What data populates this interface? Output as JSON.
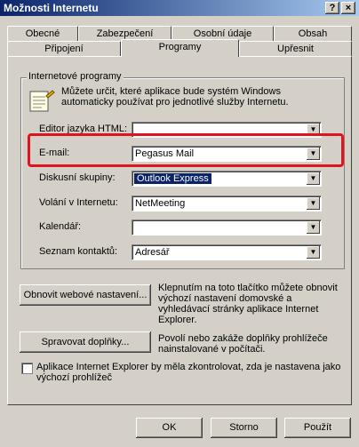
{
  "window": {
    "title": "Možnosti Internetu",
    "help_button": "?",
    "close_button": "×"
  },
  "tabs": {
    "row_back": [
      "Obecné",
      "Zabezpečení",
      "Osobní údaje",
      "Obsah"
    ],
    "row_front": [
      "Připojení",
      "Programy",
      "Upřesnit"
    ],
    "active": "Programy"
  },
  "group": {
    "title": "Internetové programy",
    "description": "Můžete určit, které aplikace bude systém Windows automaticky používat pro jednotlivé služby Internetu."
  },
  "fields": [
    {
      "label": "Editor jazyka HTML:",
      "value": ""
    },
    {
      "label": "E-mail:",
      "value": "Pegasus Mail"
    },
    {
      "label": "Diskusní skupiny:",
      "value": "Outlook Express"
    },
    {
      "label": "Volání v Internetu:",
      "value": "NetMeeting"
    },
    {
      "label": "Kalendář:",
      "value": ""
    },
    {
      "label": "Seznam kontaktů:",
      "value": "Adresář"
    }
  ],
  "reset_web": {
    "button": "Obnovit webové nastavení...",
    "description": "Klepnutím na toto tlačítko můžete obnovit výchozí nastavení domovské a vyhledávací stránky aplikace Internet Explorer."
  },
  "manage_addons": {
    "button": "Spravovat doplňky...",
    "description": "Povolí nebo zakáže doplňky prohlížeče nainstalované v počítači."
  },
  "check_default": {
    "label": "Aplikace Internet Explorer by měla zkontrolovat, zda je nastavena jako výchozí prohlížeč",
    "checked": false
  },
  "buttons": {
    "ok": "OK",
    "cancel": "Storno",
    "apply": "Použít"
  },
  "colors": {
    "highlight": "#e0141e",
    "selection": "#0a246a"
  }
}
